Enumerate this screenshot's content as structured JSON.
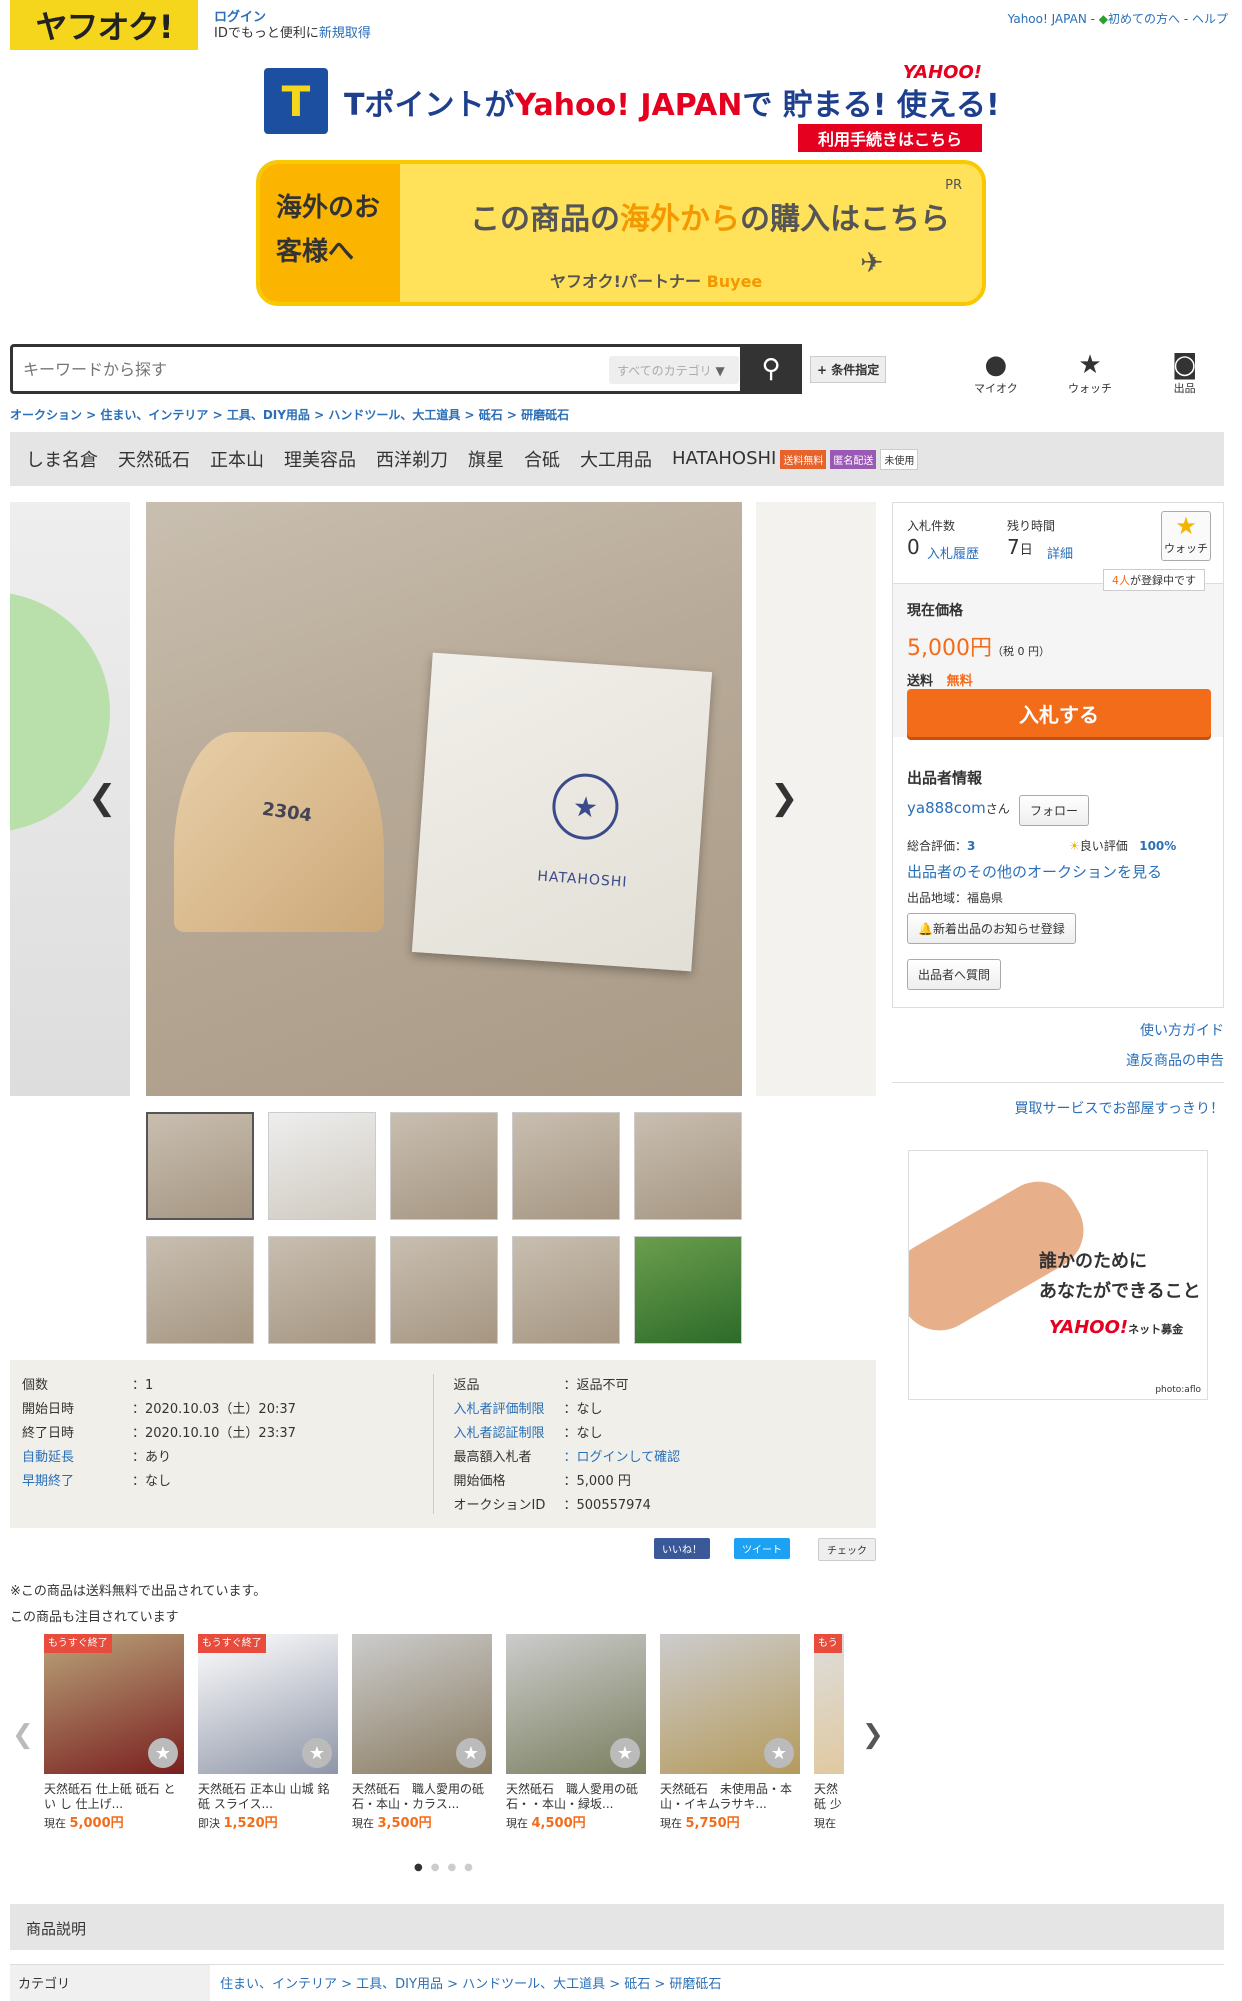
{
  "header": {
    "logo": "ヤフオク!",
    "login": "ログイン",
    "login_sub_prefix": "IDでもっと便利に",
    "signup": "新規取得",
    "links": [
      "Yahoo! JAPAN",
      "初めての方へ",
      "ヘルプ"
    ]
  },
  "banner_t": {
    "t_mark": "T",
    "text_pre": "Tポイントが",
    "text_brand": "Yahoo! JAPAN",
    "text_post": "で 貯まる! 使える!",
    "yj": "YAHOO!",
    "btn": "利用手続きはこちら"
  },
  "banner_buyee": {
    "left": "海外のお客様へ",
    "main_pre": "この商品の",
    "main_em": "海外から",
    "main_post": "の購入はこちら",
    "sub_pre": "ヤフオク!パートナー",
    "sub_brand": "Buyee",
    "pr": "PR"
  },
  "search": {
    "placeholder": "キーワードから探す",
    "category": "すべてのカテゴリ",
    "conditions": "+ 条件指定",
    "icons": [
      "マイオク",
      "ウォッチ",
      "出品"
    ]
  },
  "breadcrumb": "オークション > 住まい、インテリア > 工具、DIY用品 > ハンドツール、大工道具 > 砥石 > 研磨砥石",
  "tags": [
    "しま名倉",
    "天然砥石",
    "正本山",
    "理美容品",
    "西洋剃刀",
    "旗星",
    "合砥",
    "大工用品",
    "HATAHOSHI"
  ],
  "tag_badges": [
    "送料無料",
    "匿名配送",
    "未使用"
  ],
  "image": {
    "stone_label": "2304",
    "box_label": "HATAHOSHI"
  },
  "bid": {
    "bids_label": "入札件数",
    "bids": "0",
    "history": "入札履歴",
    "remain_label": "残り時間",
    "remain": "7",
    "remain_unit": "日",
    "detail": "詳細",
    "watch": "ウォッチ",
    "watch_count": "4人",
    "watch_suffix": "が登録中です",
    "price_label": "現在価格",
    "price": "5,000円",
    "tax": "（税 0 円）",
    "ship_label": "送料",
    "ship": "無料",
    "bid_btn": "入札する"
  },
  "seller": {
    "title": "出品者情報",
    "name": "ya888com",
    "name_suffix": "さん",
    "follow": "フォロー",
    "rating_label": "総合評価：",
    "rating": "3",
    "good_label": "良い評価",
    "good": "100%",
    "other": "出品者のその他のオークションを見る",
    "region": "出品地域：福島県",
    "notify": "新着出品のお知らせ登録",
    "question": "出品者へ質問"
  },
  "side_links": [
    "使い方ガイド",
    "違反商品の申告",
    "買取サービスでお部屋すっきり！"
  ],
  "ad": {
    "line1": "誰かのために",
    "line2": "あなたができること",
    "brand": "YAHOO!",
    "brand_sub": "ネット募金",
    "credit": "photo:aflo"
  },
  "info_left": [
    {
      "k": "個数",
      "v": "：1"
    },
    {
      "k": "開始日時",
      "v": "：2020.10.03（土）20:37"
    },
    {
      "k": "終了日時",
      "v": "：2020.10.10（土）23:37"
    },
    {
      "k": "自動延長",
      "v": "：あり"
    },
    {
      "k": "早期終了",
      "v": "：なし"
    }
  ],
  "info_right": [
    {
      "k": "返品",
      "v": "：返品不可"
    },
    {
      "k": "入札者評価制限",
      "v": "：なし"
    },
    {
      "k": "入札者認証制限",
      "v": "：なし"
    },
    {
      "k": "最高額入札者",
      "v": "：ログインして確認"
    },
    {
      "k": "開始価格",
      "v": "：5,000 円"
    },
    {
      "k": "オークションID",
      "v": "：500557974"
    }
  ],
  "social": [
    "いいね！",
    "ツイート",
    "チェック"
  ],
  "notes": [
    "※この商品は送料無料で出品されています。",
    "この商品も注目されています"
  ],
  "recommend": [
    {
      "tag": "もうすぐ終了",
      "title": "天然砥石 仕上砥 砥石 とい し 仕上げ...",
      "plabel": "現在",
      "price": "5,000円"
    },
    {
      "tag": "もうすぐ終了",
      "title": "天然砥石 正本山 山城 銘 砥 スライス...",
      "plabel": "即決",
      "price": "1,520円"
    },
    {
      "tag": "",
      "title": "天然砥石　職人愛用の砥石・本山・カラス...",
      "plabel": "現在",
      "price": "3,500円"
    },
    {
      "tag": "",
      "title": "天然砥石　職人愛用の砥石・・本山・緑坂...",
      "plabel": "現在",
      "price": "4,500円"
    },
    {
      "tag": "",
      "title": "天然砥石　未使用品・本山・イキムラサキ...",
      "plabel": "現在",
      "price": "5,750円"
    },
    {
      "tag": "もう",
      "title": "天然砥 少",
      "plabel": "現在",
      "price": ""
    }
  ],
  "desc_title": "商品説明",
  "category_label": "カテゴリ",
  "category_value": "住まい、インテリア > 工具、DIY用品 > ハンドツール、大工道具 > 砥石 > 研磨砥石"
}
